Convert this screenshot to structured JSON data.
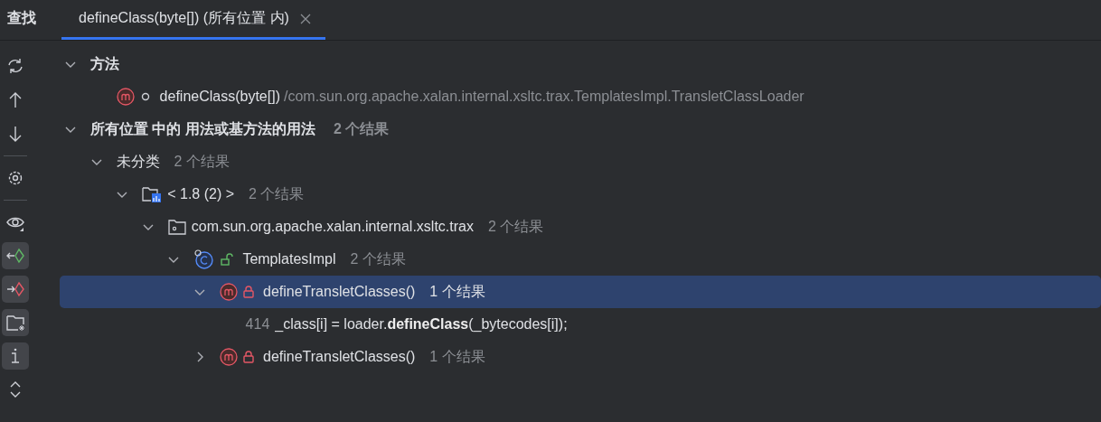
{
  "panel": {
    "title": "查找"
  },
  "tabs": [
    {
      "label": "defineClass(byte[]) (所有位置 内)",
      "selected": true
    }
  ],
  "toolbar": [
    {
      "kind": "refresh",
      "on": false
    },
    {
      "kind": "up",
      "on": false
    },
    {
      "kind": "down",
      "on": false
    },
    {
      "kind": "divider"
    },
    {
      "kind": "settings",
      "on": false
    },
    {
      "kind": "divider"
    },
    {
      "kind": "preview",
      "on": false
    },
    {
      "kind": "read",
      "on": true
    },
    {
      "kind": "write",
      "on": true
    },
    {
      "kind": "folder",
      "on": true
    },
    {
      "kind": "info",
      "on": true
    },
    {
      "kind": "expand",
      "on": false
    }
  ],
  "tree": [
    {
      "kind": "group",
      "label": "方法",
      "expanded": true,
      "selected": false,
      "children": [
        {
          "kind": "method",
          "label": "defineClass(byte[])",
          "path": "/com.sun.org.apache.xalan.internal.xsltc.trax.TemplatesImpl.TransletClassLoader",
          "selected": false
        }
      ]
    },
    {
      "kind": "group",
      "label": "所有位置 中的 用法或基方法的用法",
      "count": "2 个结果",
      "expanded": true,
      "selected": false,
      "children": [
        {
          "kind": "category",
          "label": "未分类",
          "count": "2 个结果",
          "expanded": true,
          "selected": false,
          "children": [
            {
              "kind": "library",
              "label": "< 1.8 (2) >",
              "count": "2 个结果",
              "expanded": true,
              "selected": false,
              "children": [
                {
                  "kind": "package",
                  "label": "com.sun.org.apache.xalan.internal.xsltc.trax",
                  "count": "2 个结果",
                  "expanded": true,
                  "selected": false,
                  "children": [
                    {
                      "kind": "class",
                      "label": "TemplatesImpl",
                      "count": "2 个结果",
                      "expanded": true,
                      "selected": false,
                      "children": [
                        {
                          "kind": "private_method",
                          "label": "defineTransletClasses()",
                          "count": "1 个结果",
                          "expanded": true,
                          "selected": true,
                          "children": [
                            {
                              "kind": "usage",
                              "line": "414",
                              "label": "_class[i] = loader.**defineClass**(_bytecodes[i]);",
                              "selected": false
                            }
                          ]
                        },
                        {
                          "kind": "private_method",
                          "label": "defineTransletClasses()",
                          "count": "1 个结果",
                          "expanded": false,
                          "selected": false
                        }
                      ]
                    }
                  ]
                }
              ]
            }
          ]
        }
      ]
    }
  ]
}
